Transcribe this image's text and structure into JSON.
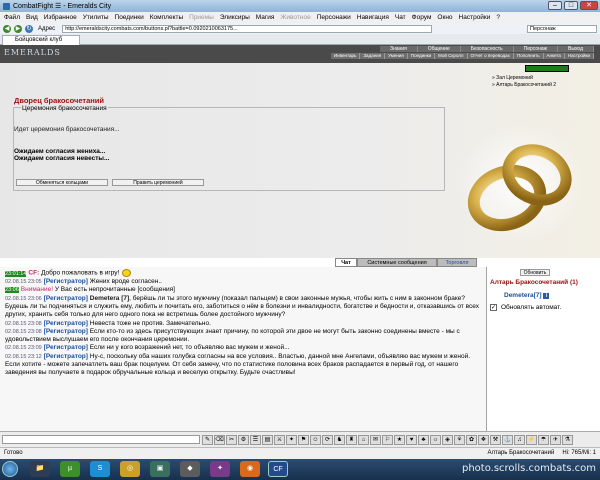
{
  "window": {
    "title": "CombatFight ☰ - Emeralds City"
  },
  "menu": [
    {
      "label": "Файл",
      "enabled": true
    },
    {
      "label": "Вид",
      "enabled": true
    },
    {
      "label": "Избранное",
      "enabled": true
    },
    {
      "label": "Утилиты",
      "enabled": true
    },
    {
      "label": "Поединки",
      "enabled": true
    },
    {
      "label": "Комплекты",
      "enabled": true
    },
    {
      "label": "Приемы",
      "enabled": false
    },
    {
      "label": "Эликсиры",
      "enabled": true
    },
    {
      "label": "Магия",
      "enabled": true
    },
    {
      "label": "Животное",
      "enabled": false
    },
    {
      "label": "Персонажи",
      "enabled": true
    },
    {
      "label": "Навигация",
      "enabled": true
    },
    {
      "label": "Чат",
      "enabled": true
    },
    {
      "label": "Форум",
      "enabled": true
    },
    {
      "label": "Окно",
      "enabled": true
    },
    {
      "label": "Настройки",
      "enabled": true
    },
    {
      "label": "?",
      "enabled": true
    }
  ],
  "address": {
    "label": "Адрес",
    "url": "http://emeraldscity.combats.com/buttons.pl?battle=0.0920210063175...",
    "search_placeholder": "Персонаж"
  },
  "tab": {
    "label": "Бойцовский клуб"
  },
  "game": {
    "logo": "EMERALDS",
    "nav_top": [
      "Знания",
      "Общение",
      "Безопасность",
      "Персонаж",
      "Выход"
    ],
    "nav_bottom": [
      "Инвентарь",
      "Задания",
      "Умения",
      "Поединки",
      "Мой Скролл",
      "Отчет о переводах",
      "Пополнить",
      "Анкета",
      "Настройки"
    ],
    "right_links": [
      "» Зал Церемоний",
      "» Алтарь Бракосочетаний 2"
    ]
  },
  "ceremony": {
    "title": "Дворец бракосочетаний",
    "legend": "Церемония бракосочетания",
    "status": "Идет церемония бракосочетания...",
    "wait_groom": "Ожидаем согласия жениха...",
    "wait_bride": "Ожидаем согласия невесты...",
    "btn_rings": "Обменяться кольцами",
    "btn_lead": "Править церемонией"
  },
  "chat_tabs": [
    "Чат",
    "Системные сообщения",
    "Торговля"
  ],
  "chat": [
    {
      "ts": "23:01:14",
      "kind": "green",
      "prefix": "CF:",
      "text": "Добро пожаловать в игру!"
    },
    {
      "ts": "02.08.15 23:05",
      "kind": "reg",
      "prefix": "[Регистратор]",
      "text": "Жених вроде согласен.."
    },
    {
      "ts": "23:06",
      "kind": "pink",
      "prefix": "Внимание!",
      "text": "У Вас есть непрочитанные [сообщения]"
    },
    {
      "ts": "02.08.15 23:06",
      "kind": "reg",
      "prefix": "[Регистратор]",
      "name": "Demetera [7]",
      "text": ", берёшь ли ты этого мужчину (показал пальцем) в свои законные мужья, чтобы жить с ним в законном браке? Будешь ли ты подчиняться и служить ему, любить и почитать его, заботиться о нём в болезни и инвалидности, богатстве и бедности и, отказавшись от всех других, хранить себя только для него одного пока не встретишь более достойного мужчину?"
    },
    {
      "ts": "02.08.15 23:08",
      "kind": "reg",
      "prefix": "[Регистратор]",
      "text": "Невеста тоже не против. Замечательно."
    },
    {
      "ts": "02.08.15 23:08",
      "kind": "reg",
      "prefix": "[Регистратор]",
      "text": "Если кто-то из здесь присутствующих знает причину, по которой эти двое не могут быть законно соединены вместе - мы с удовольствием выслушаем его после окончания церемонии."
    },
    {
      "ts": "02.08.15 23:09",
      "kind": "reg",
      "prefix": "[Регистратор]",
      "text": "Если ни у кого возражений нет, то объявляю вас мужем и женой..."
    },
    {
      "ts": "02.08.15 23:12",
      "kind": "reg",
      "prefix": "[Регистратор]",
      "text": "Ну-с, поскольку оба наших голубка согласны на все условия.. Властью, данной мне Ангелами, объявляю вас мужем и женой. Если хотите - можете запечатлеть ваш брак поцелуем. От себя замечу, что по статистике половина всех браков распадается в первый год, от нашего заведения вы получаете в подарок обручальные кольца и веселую открытку. Будьте счастливы!"
    }
  ],
  "side": {
    "refresh": "Обновить",
    "title": "Алтарь Бракосочетаний (1)",
    "user": "Demetera[7]",
    "auto": "Обновлять автомат."
  },
  "statusbar": {
    "left": "Готово",
    "room": "Алтарь Бракосочетаний",
    "hp": "Hi: 765/Mi: 1"
  },
  "taskbar": {
    "watermark": "photo.scrolls.combats.com"
  }
}
